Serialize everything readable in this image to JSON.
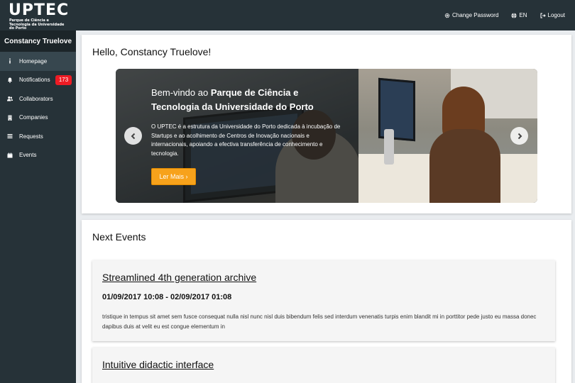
{
  "brand": {
    "title": "UPTEC",
    "subtitle": "Parque de Ciência e Tecnologia da Universidade do Porto"
  },
  "topnav": {
    "change_password": "Change Password",
    "language": "EN",
    "logout": "Logout"
  },
  "sidebar": {
    "user": "Constancy Truelove",
    "items": [
      {
        "label": "Homepage",
        "icon": "info-icon",
        "active": true
      },
      {
        "label": "Notifications",
        "icon": "bell-icon",
        "badge": "173"
      },
      {
        "label": "Collaborators",
        "icon": "users-icon"
      },
      {
        "label": "Companies",
        "icon": "building-icon"
      },
      {
        "label": "Requests",
        "icon": "list-icon"
      },
      {
        "label": "Events",
        "icon": "calendar-icon"
      }
    ]
  },
  "welcome": {
    "greeting": "Hello, Constancy Truelove!"
  },
  "carousel": {
    "title_plain": "Bem-vindo ao ",
    "title_bold_1": "Parque de Ciência e",
    "title_bold_2": "Tecnologia da Universidade do Porto",
    "text": "O UPTEC é a estrutura da Universidade do Porto dedicada à incubação de Startups e ao acolhimento de Centros de Inovação nacionais e internacionais, apoiando a efectiva transferência de conhecimento e tecnologia.",
    "button": "Ler Mais ›"
  },
  "events": {
    "title": "Next Events",
    "items": [
      {
        "title": "Streamlined 4th generation archive",
        "date": "01/09/2017 10:08 - 02/09/2017 01:08",
        "description": "tristique in tempus sit amet sem fusce consequat nulla nisl nunc nisl duis bibendum felis sed interdum venenatis turpis enim blandit mi in porttitor pede justo eu massa donec dapibus duis at velit eu est congue elementum in"
      },
      {
        "title": "Intuitive didactic interface"
      }
    ]
  },
  "colors": {
    "topbar": "#263238",
    "sidebar_active": "#37474f",
    "badge": "#ee1b24",
    "accent_button": "#f7a21b"
  }
}
